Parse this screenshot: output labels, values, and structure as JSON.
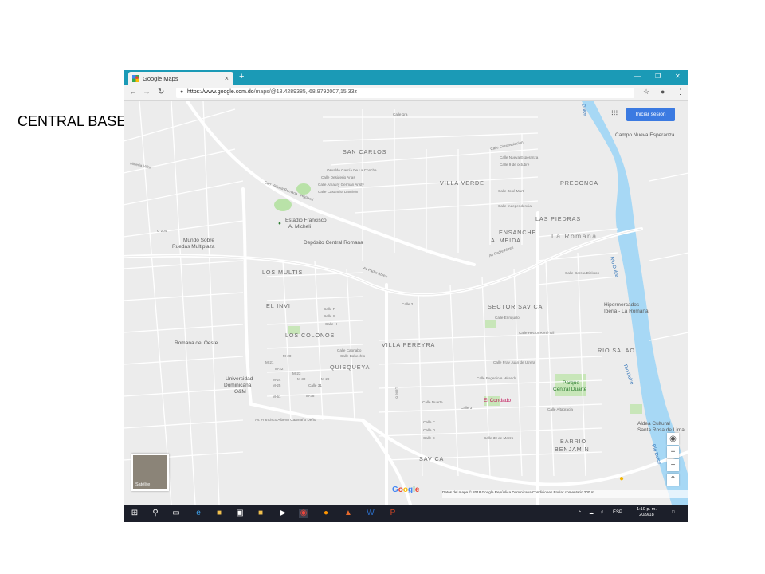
{
  "slide": {
    "label": "CENTRAL BASE"
  },
  "browser": {
    "tab_title": "Google Maps",
    "tab_close": "×",
    "new_tab": "+",
    "window_controls": [
      "—",
      "❐",
      "✕"
    ],
    "url_prefix": "https://www.google.com.do",
    "url_rest": "/maps/@18.4289385,-68.9792007,15.33z",
    "nav": {
      "back": "←",
      "forward": "→",
      "reload": "↻"
    },
    "icons": {
      "star": "☆",
      "account": "●",
      "menu": "⋮",
      "lock": "🔒"
    }
  },
  "map": {
    "signin_label": "Iniciar sesión",
    "apps_icon": "⁞⁞⁞",
    "satellite_label": "Satélite",
    "google_logo": "Google",
    "footer": "Datos del mapa © 2018 Google   República Dominicana   Condiciones   Enviar comentario   200 m",
    "zoom_in": "+",
    "zoom_out": "−",
    "locate": "◉",
    "expand": "⌃",
    "city_label": "La Romana",
    "neighborhoods": {
      "san_carlos": "SAN CARLOS",
      "villa_verde": "VILLA VERDE",
      "preconca": "PRECONCA",
      "las_piedras": "LAS PIEDRAS",
      "ensanche": "ENSANCHE",
      "almeida": "ALMEIDA",
      "los_multis": "LOS MULTIS",
      "el_invi": "EL INVI",
      "sector_savica": "SECTOR SAVICA",
      "los_colonos": "LOS COLONOS",
      "villa_pereyra": "VILLA PEREYRA",
      "rio_salao": "RIO SALAO",
      "quisqueya": "QUISQUEYA",
      "barrio": "BARRIO",
      "benjamin": "BENJAMIN",
      "savica": "SAVICA"
    },
    "pois": {
      "estadio_1": "Estadio Francisco",
      "estadio_2": "A. Micheli",
      "deposito": "Depósito Central Romana",
      "mundo_1": "Mundo Sobre",
      "mundo_2": "Ruedas Multiplaza",
      "campo": "Campo Nueva Esperanza",
      "hiper_1": "Hipermercados",
      "hiper_2": "Iberia - La Romana",
      "romana_oeste": "Romana del Oeste",
      "universidad_1": "Universidad",
      "universidad_2": "Dominicana",
      "universidad_3": "O&M",
      "parque_1": "Parque",
      "parque_2": "Central Duarte",
      "condado": "El Condado",
      "aldea_1": "Aldea Cultural",
      "aldea_2": "Santa Rosa de Lima"
    },
    "water": {
      "rio_dulce_1": "Río Dulce",
      "rio_dulce_2": "Río Dulce",
      "rio_dulce_3": "Río Dulce",
      "dulce_top": "Dulce"
    },
    "streets": {
      "av_padre_abreu_1": "Av Padre Abreu",
      "av_padre_abreu_2": "Av Padre Abreu",
      "car_higuey": "Carr Vieja la Romana - Higüeral",
      "av_camano": "Av. Francisco Alberto Caamaño Deño",
      "osvaldo": "Osvaldo García De La Concha",
      "desiderio": "Calle Desiderio Arias",
      "amaury": "Calle Amaury German Aristy",
      "casandra": "Calle Casandra Damirón",
      "circunvalacion": "Calle Circunvalación",
      "nueva_esperanza": "Calle Nueva Esperanza",
      "nueve_octubre": "Calle 9 de octubre",
      "jose_marti": "Calle José Martí",
      "independencia": "Calle Independencia",
      "garcia_dickson": "Calle García Dickson",
      "enriquillo": "Calle Enriquillo",
      "hector_rene": "Calle Héctor René Gil",
      "fray_juan": "Calle Fray Juan de Utrera",
      "eugenio": "Calle Eugenio A Miranda",
      "altagracia": "Calle Altagracia",
      "duarte": "Calle Duarte",
      "treinta_marzo": "Calle 30 de Marzo",
      "calle_d": "Calle D",
      "calle_e": "Calle E",
      "calle_c": "Calle C",
      "calle_2": "Calle 2",
      "calle_3": "Calle 3",
      "calle_8": "Calle 8",
      "calle_f": "Calle F",
      "calle_g": "Calle G",
      "calle_h": "Calle H",
      "calle_caonabo": "Calle Caonabo",
      "bohechio": "Calle Bohechío",
      "m20": "M-20",
      "m22": "M-22",
      "m23": "M-23",
      "m24": "M-24",
      "m25": "M-25",
      "m21": "M-21",
      "m29": "M-29",
      "m30": "M-30",
      "m38": "M-38",
      "m51": "M-51",
      "calle_31": "Calle 31",
      "c204": "C 204",
      "mineria": "Minería Villar",
      "calle_tira": "Calle 1ra"
    }
  },
  "taskbar": {
    "time": "1:10 p. m.",
    "date": "20/9/18",
    "lang": "ESP",
    "icons": [
      "windows-icon",
      "search-icon",
      "task-view-icon",
      "edge-icon",
      "file-explorer-icon",
      "store-icon",
      "folder-icon",
      "media-icon",
      "chrome-icon",
      "firefox-icon",
      "paint-icon",
      "word-icon",
      "powerpoint-icon"
    ]
  }
}
